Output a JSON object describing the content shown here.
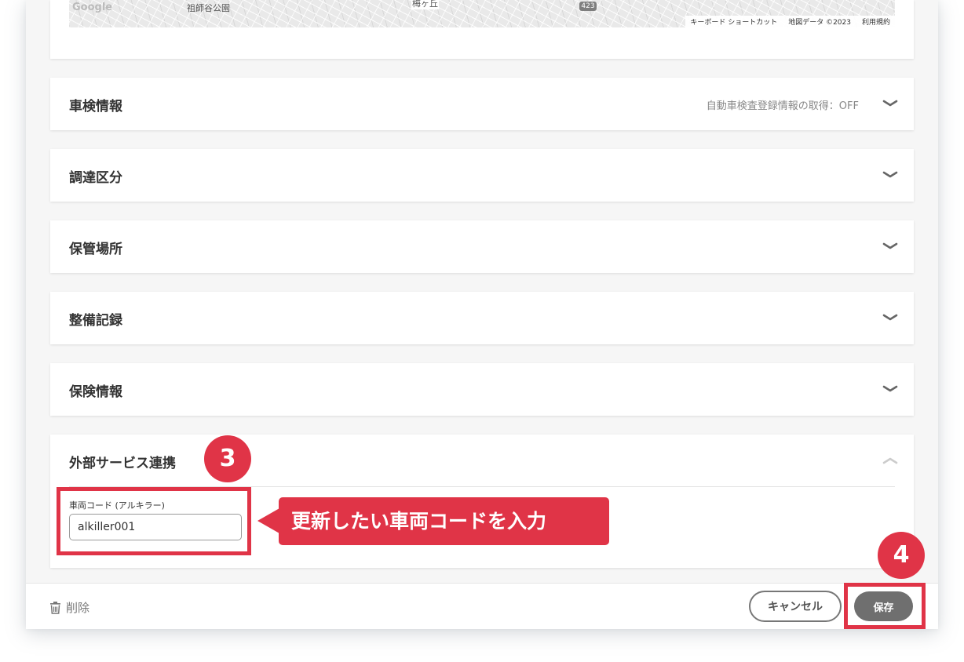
{
  "map": {
    "google": "Google",
    "labels": [
      "祖師谷公園",
      "梅ヶ丘",
      "423"
    ],
    "footer": {
      "shortcuts": "キーボード ショートカット",
      "map_data": "地図データ ©2023",
      "terms": "利用規約"
    }
  },
  "panels": [
    {
      "title": "車検情報",
      "meta": "自動車検査登録情報の取得：OFF",
      "state": "collapsed"
    },
    {
      "title": "調達区分",
      "state": "collapsed"
    },
    {
      "title": "保管場所",
      "state": "collapsed"
    },
    {
      "title": "整備記録",
      "state": "collapsed"
    },
    {
      "title": "保険情報",
      "state": "collapsed"
    }
  ],
  "external": {
    "title": "外部サービス連携",
    "state": "expanded",
    "field_label": "車両コード (アルキラー)",
    "field_value": "alkiller001"
  },
  "footer": {
    "delete_label": "削除",
    "cancel_label": "キャンセル",
    "save_label": "保存"
  },
  "annotations": {
    "step3": "3",
    "step4": "4",
    "callout_text": "更新したい車両コードを入力",
    "accent_color": "#e03447"
  },
  "icons": {
    "chevron_down": "chevron-down-icon",
    "chevron_up": "chevron-up-icon",
    "trash": "trash-icon"
  }
}
